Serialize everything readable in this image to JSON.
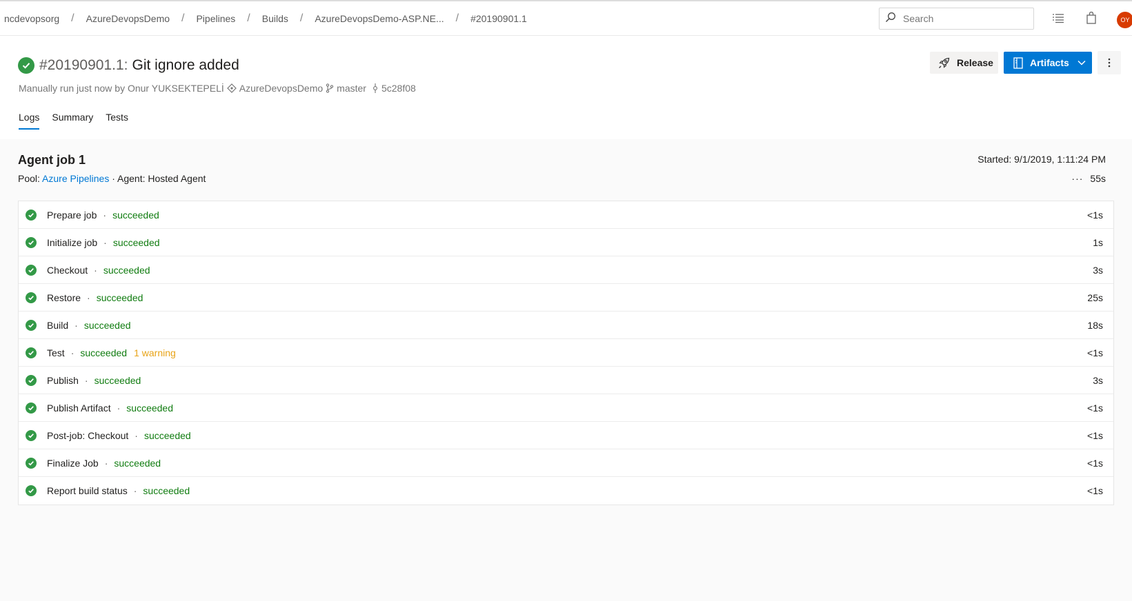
{
  "breadcrumb": [
    "ncdevopsorg",
    "AzureDevopsDemo",
    "Pipelines",
    "Builds",
    "AzureDevopsDemo-ASP.NE...",
    "#20190901.1"
  ],
  "search": {
    "placeholder": "Search"
  },
  "user": {
    "initials": "OY"
  },
  "build": {
    "number": "#20190901.1",
    "message": "Git ignore added",
    "run_text": "Manually run just now by Onur YUKSEKTEPELİ",
    "repo": "AzureDevopsDemo",
    "branch": "master",
    "commit": "5c28f08"
  },
  "actions": {
    "release_label": "Release",
    "artifacts_label": "Artifacts"
  },
  "tabs": [
    {
      "label": "Logs",
      "active": true
    },
    {
      "label": "Summary",
      "active": false
    },
    {
      "label": "Tests",
      "active": false
    }
  ],
  "job": {
    "title": "Agent job 1",
    "pool_label": "Pool:",
    "pool_name": "Azure Pipelines",
    "agent_text": "· Agent: Hosted Agent",
    "started": "Started: 9/1/2019, 1:11:24 PM",
    "duration": "55s",
    "steps": [
      {
        "name": "Prepare job",
        "status": "succeeded",
        "warning": "",
        "duration": "<1s"
      },
      {
        "name": "Initialize job",
        "status": "succeeded",
        "warning": "",
        "duration": "1s"
      },
      {
        "name": "Checkout",
        "status": "succeeded",
        "warning": "",
        "duration": "3s"
      },
      {
        "name": "Restore",
        "status": "succeeded",
        "warning": "",
        "duration": "25s"
      },
      {
        "name": "Build",
        "status": "succeeded",
        "warning": "",
        "duration": "18s"
      },
      {
        "name": "Test",
        "status": "succeeded",
        "warning": "1 warning",
        "duration": "<1s"
      },
      {
        "name": "Publish",
        "status": "succeeded",
        "warning": "",
        "duration": "3s"
      },
      {
        "name": "Publish Artifact",
        "status": "succeeded",
        "warning": "",
        "duration": "<1s"
      },
      {
        "name": "Post-job: Checkout",
        "status": "succeeded",
        "warning": "",
        "duration": "<1s"
      },
      {
        "name": "Finalize Job",
        "status": "succeeded",
        "warning": "",
        "duration": "<1s"
      },
      {
        "name": "Report build status",
        "status": "succeeded",
        "warning": "",
        "duration": "<1s"
      }
    ]
  },
  "colors": {
    "accent": "#0078d4",
    "success": "#339947",
    "success_text": "#107c10",
    "warning": "#e8a317",
    "avatar": "#d83b01"
  },
  "icons": [
    "search-icon",
    "list-icon",
    "shopping-bag-icon",
    "success-check-icon",
    "git-repo-icon",
    "branch-icon",
    "commit-icon",
    "rocket-icon",
    "artifact-icon",
    "chevron-down-icon",
    "more-vertical-icon",
    "more-horizontal-icon"
  ]
}
